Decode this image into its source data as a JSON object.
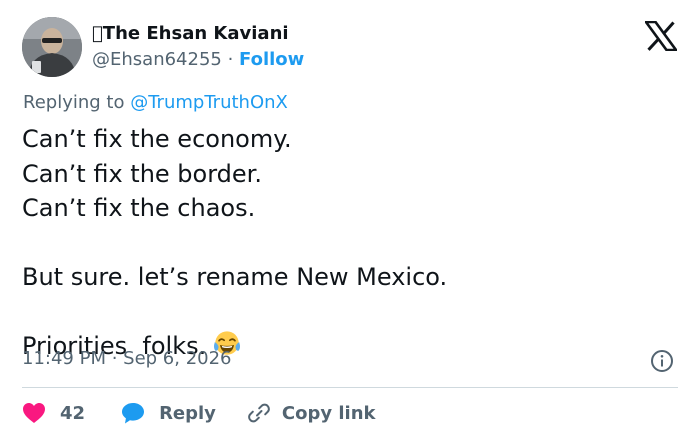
{
  "author": {
    "display_name": "\u0000The Ehsan Kaviani",
    "handle": "@Ehsan64255",
    "separator": " · ",
    "follow_label": "Follow"
  },
  "reply_context": {
    "prefix": "Replying to ",
    "mention": "@TrumpTruthOnX"
  },
  "tweet": {
    "lines": [
      "Can’t fix the economy.",
      "Can’t fix the border.",
      "Can’t fix the chaos.",
      "",
      "But sure. let’s rename New Mexico.",
      "",
      "Priorities  folks."
    ],
    "emoji": "face-with-tears-of-joy-emoji",
    "timestamp": "11:49 PM · Sep 6, 2026"
  },
  "actions": {
    "like_count": "42",
    "reply_label": "Reply",
    "copy_link_label": "Copy link"
  },
  "icons": {
    "logo": "x-logo-icon",
    "info": "info-icon",
    "like": "heart-icon",
    "reply": "speech-bubble-icon",
    "copy": "link-icon"
  },
  "colors": {
    "accent": "#1d9bf0",
    "like": "#f91880",
    "text_primary": "#0f1419",
    "text_secondary": "#536471",
    "divider": "#cfd9de"
  }
}
